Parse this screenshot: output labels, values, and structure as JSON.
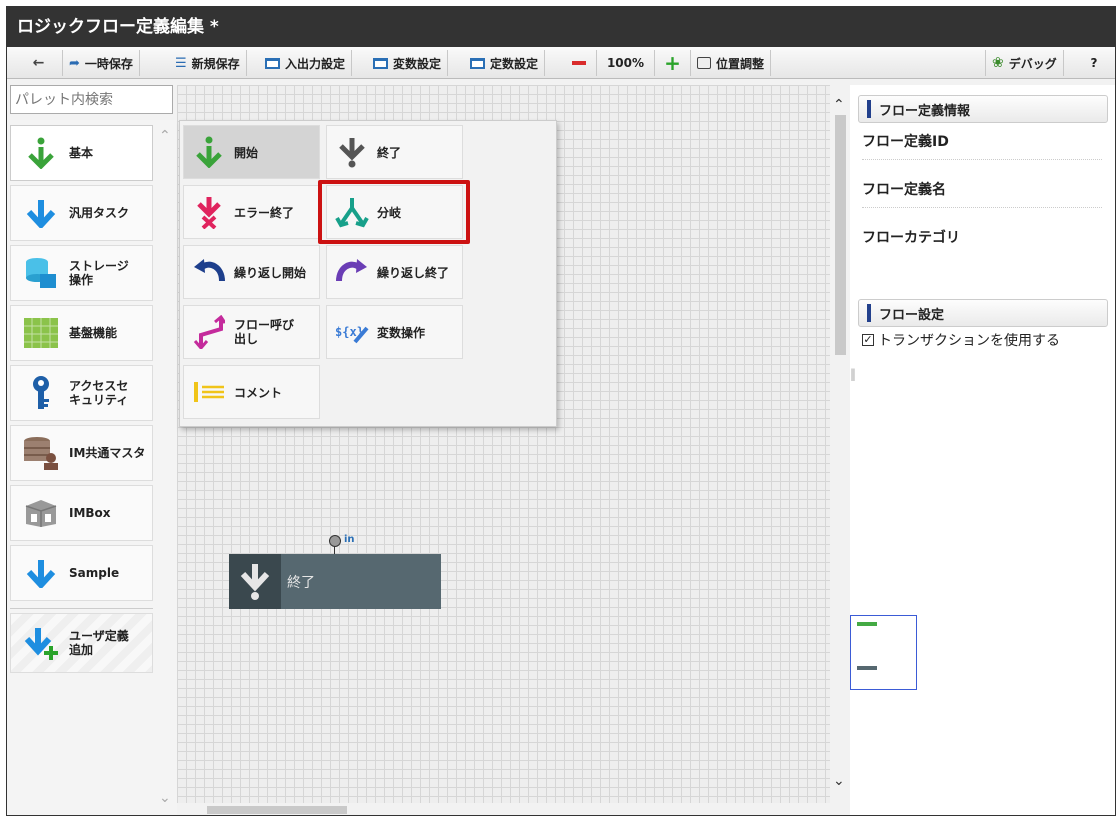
{
  "window": {
    "title": "ロジックフロー定義編集 *"
  },
  "toolbar": {
    "back_icon": "arrow-left-icon",
    "temp_save": "一時保存",
    "new_save": "新規保存",
    "io_settings": "入出力設定",
    "var_settings": "変数設定",
    "const_settings": "定数設定",
    "zoom": "100%",
    "position_adjust": "位置調整",
    "debug": "デバッグ",
    "help": "?"
  },
  "palette": {
    "search_placeholder": "パレット内検索",
    "items": [
      {
        "label": "基本",
        "icon": "down-arrow-green-icon"
      },
      {
        "label": "汎用タスク",
        "icon": "down-arrow-blue-icon"
      },
      {
        "label": "ストレージ操作",
        "icon": "storage-icon"
      },
      {
        "label": "基盤機能",
        "icon": "grid-tiles-icon"
      },
      {
        "label": "アクセスセキュリティ",
        "icon": "key-icon"
      },
      {
        "label": "IM共通マスタ",
        "icon": "database-user-icon"
      },
      {
        "label": "IMBox",
        "icon": "box-icon"
      },
      {
        "label": "Sample",
        "icon": "down-arrow-blue-icon"
      },
      {
        "label": "ユーザ定義追加",
        "icon": "add-user-defined-icon"
      }
    ]
  },
  "popup_nodes": [
    {
      "label": "開始",
      "icon": "start-icon"
    },
    {
      "label": "終了",
      "icon": "end-icon"
    },
    {
      "label": "エラー終了",
      "icon": "error-end-icon"
    },
    {
      "label": "分岐",
      "icon": "branch-icon"
    },
    {
      "label": "繰り返し開始",
      "icon": "loop-start-icon"
    },
    {
      "label": "繰り返し終了",
      "icon": "loop-end-icon"
    },
    {
      "label": "フロー呼び出し",
      "icon": "flow-call-icon"
    },
    {
      "label": "変数操作",
      "icon": "variable-op-icon"
    },
    {
      "label": "コメント",
      "icon": "comment-icon"
    }
  ],
  "canvas": {
    "node_label": "終了",
    "port_label": "in"
  },
  "right_panel": {
    "flow_info_header": "フロー定義情報",
    "flow_id_label": "フロー定義ID",
    "flow_name_label": "フロー定義名",
    "flow_category_label": "フローカテゴリ",
    "flow_settings_header": "フロー設定",
    "use_transaction": "トランザクションを使用する",
    "use_transaction_checked": true
  },
  "colors": {
    "titlebar": "#333333",
    "highlight": "#cc1111",
    "node": "#566870",
    "accent_blue": "#22408c"
  }
}
